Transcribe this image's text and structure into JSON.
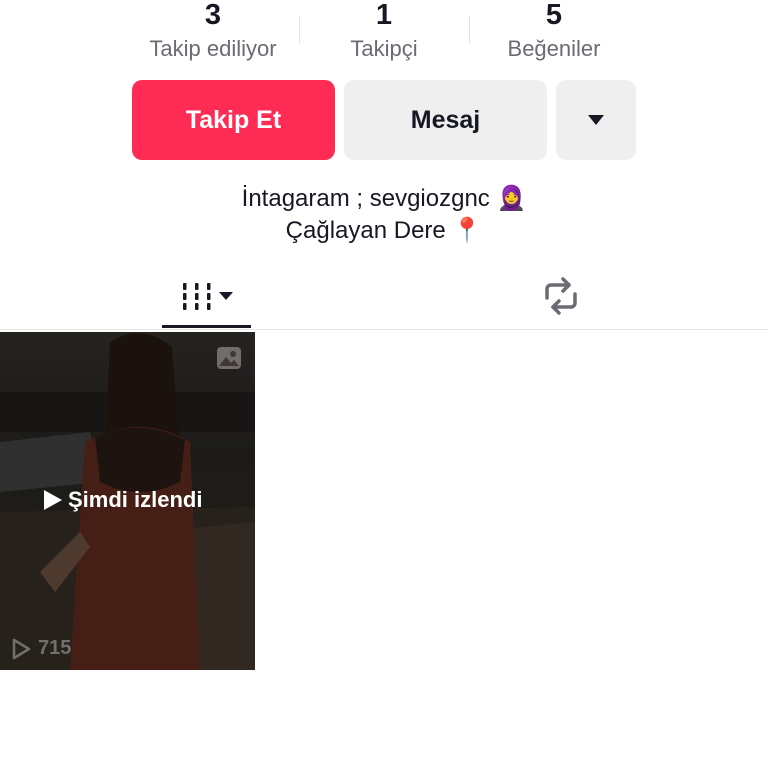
{
  "stats": {
    "following": {
      "count": "3",
      "label": "Takip ediliyor"
    },
    "followers": {
      "count": "1",
      "label": "Takipçi"
    },
    "likes": {
      "count": "5",
      "label": "Beğeniler"
    }
  },
  "buttons": {
    "follow": "Takip Et",
    "message": "Mesaj"
  },
  "bio": {
    "line1": "İntagaram ; sevgiozgnc 🧕",
    "line2": "Çağlayan Dere 📍"
  },
  "tabs": {
    "videos_icon": "grid-icon",
    "reposts_icon": "repost-icon"
  },
  "video": {
    "watched_label": "Şimdi izlendi",
    "views": "715",
    "type_icon": "photo-icon"
  },
  "colors": {
    "accent": "#fe2c55",
    "button_gray": "#efefef",
    "text": "#161823",
    "secondary_text": "#6a6b73"
  }
}
